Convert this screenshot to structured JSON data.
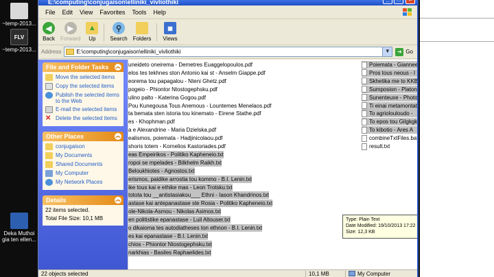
{
  "desktop": {
    "icons": [
      {
        "label": "~temp-2013...",
        "color": "#d9d9d9"
      },
      {
        "label": "~temp-2013...",
        "color": "#3a3a3a"
      },
      {
        "label": "Deka Muthoi gia ten ellen...",
        "color": "#2c5fb0"
      }
    ],
    "flv_badge": "FLV"
  },
  "window": {
    "title": "E:\\computing\\conjugaison\\elliniki_vivliothiki",
    "menu": [
      "File",
      "Edit",
      "View",
      "Favorites",
      "Tools",
      "Help"
    ],
    "toolbar": {
      "back": "Back",
      "forward": "Forward",
      "up": "Up",
      "search": "Search",
      "folders": "Folders",
      "views": "Views"
    },
    "address": {
      "label": "Address",
      "value": "E:\\computing\\conjugaison\\elliniki_vivliothiki",
      "go": "Go"
    }
  },
  "taskpane": {
    "file_tasks": {
      "title": "File and Folder Tasks",
      "items": [
        "Move the selected items",
        "Copy the selected items",
        "Publish the selected items to the Web",
        "E-mail the selected items",
        "Delete the selected items"
      ]
    },
    "other_places": {
      "title": "Other Places",
      "items": [
        "conjugaison",
        "My Documents",
        "Shared Documents",
        "My Computer",
        "My Network Places"
      ]
    },
    "details": {
      "title": "Details",
      "lines": [
        "22 items selected.",
        "Total File Size: 10,1 MB"
      ]
    }
  },
  "files_left": [
    {
      "name": "uneideto oneirema - Demetres Euaggelopoulos.pdf",
      "sel": false
    },
    {
      "name": "elos tes tekhnes ston Antonio kai st - Anselm Giappe.pdf",
      "sel": false
    },
    {
      "name": "eorema tou papagalou - Nteni Ghetz.pdf",
      "sel": false
    },
    {
      "name": "pogeio - Phiontor Ntostogephsku.pdf",
      "sel": false
    },
    {
      "name": "ulino palto - Katerina Gogou.pdf",
      "sel": false
    },
    {
      "name": "Pou Kunegousa Tous Anemous - Lountemes Menelaos.pdf",
      "sel": false
    },
    {
      "name": "ta bemata sten istoria tou kinemato - Eirene Stathe.pdf",
      "sel": false
    },
    {
      "name": "es - Khophman.pdf",
      "sel": false
    },
    {
      "name": "a e Alexandrine - Maria Dzielska.pdf",
      "sel": false
    },
    {
      "name": "ealismos, poiemata - Hadjinicolaou.pdf",
      "sel": false
    },
    {
      "name": "shoris totem - Kornelios Kastoriades.pdf",
      "sel": false
    },
    {
      "name": "eas Empeirikos - Politiko Kapheneio.txt",
      "sel": true
    },
    {
      "name": "ropoi se mpelades - Bilkhelm Raikh.txt",
      "sel": true
    },
    {
      "name": "Beloukhiotes - Agnostos.txt",
      "sel": true
    },
    {
      "name": "erismos, paidike arrostia tou kommo - B.I. Lenin.txt",
      "sel": true
    },
    {
      "name": "ike tous kai e ethike mas - Leon Trotsku.txt",
      "sel": true
    },
    {
      "name": "totota tou __antistasiakou___ Ethni - Iason Khandrinos.txt",
      "sel": true
    },
    {
      "name": "astase kai antepanastase ste Rosia - Politiko Kapheneio.txt",
      "sel": true
    },
    {
      "name": "ole-Nikola-Asmou - Nikolas Asimos.txt",
      "sel": true
    },
    {
      "name": "en politistike epanastase - Luil Altouser.txt",
      "sel": true
    },
    {
      "name": "o dikaioma tes autodiatheses ton ethnon - B.I. Lenin.txt",
      "sel": true
    },
    {
      "name": "es kai epanastase - B.I. Lenin.txt",
      "sel": true
    },
    {
      "name": "chios - Phiontor Ntostogephsku.txt",
      "sel": true
    },
    {
      "name": "narkhias - Basiles Raphaelides.txt",
      "sel": true
    }
  ],
  "files_right": [
    {
      "name": "Poiemata - Giannees",
      "sel": true
    },
    {
      "name": "Pros tous neous - I",
      "sel": true
    },
    {
      "name": "Skhetika me to KKBK",
      "sel": true
    },
    {
      "name": "Sumposion - Platonos",
      "sel": true
    },
    {
      "name": "Sunenteuxe - Photor",
      "sel": true
    },
    {
      "name": "Ti einai metamontate",
      "sel": true
    },
    {
      "name": "To agriolouloudo -",
      "sel": true
    },
    {
      "name": "To epos tou Gilgkgk",
      "sel": true
    },
    {
      "name": "To kibotio - Ares A",
      "sel": true
    },
    {
      "name": "combineTxtFiles.bat",
      "sel": false
    },
    {
      "name": "result.txt",
      "sel": false
    }
  ],
  "tooltip": {
    "lines": [
      "Type: Plain Text",
      "Date Modified: 19/10/2013 17:22",
      "Size: 12,3 KB"
    ]
  },
  "status": {
    "selected": "22 objects selected",
    "size": "10,1 MB",
    "location": "My Computer"
  },
  "colors": {
    "xp_blue": "#245edb",
    "taskpane_bg": "#6375d6",
    "selection_gray": "#c2c2c2"
  }
}
